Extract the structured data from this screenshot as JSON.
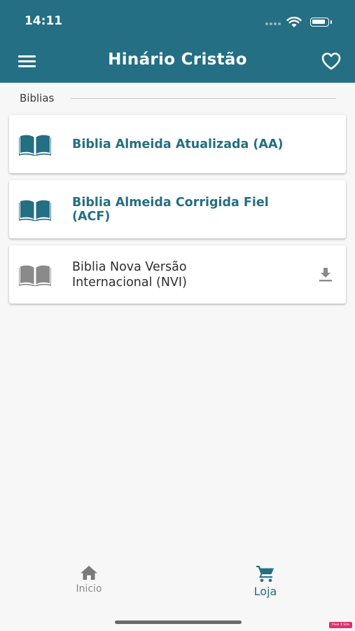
{
  "status_bar": {
    "time": "14:11"
  },
  "header": {
    "title": "Hinário Cristão",
    "menu_icon": "hamburger-icon",
    "favorites_icon": "heart-outline-icon"
  },
  "section": {
    "label": "Biblias"
  },
  "bibles": [
    {
      "title": "Biblia Almeida Atualizada (AA)",
      "owned": true,
      "icon": "book-open-icon"
    },
    {
      "title": "Biblia Almeida Corrigida Fiel (ACF)",
      "owned": true,
      "icon": "book-open-icon"
    },
    {
      "title": "Biblia Nova Versão Internacional (NVI)",
      "owned": false,
      "icon": "book-open-icon",
      "action_icon": "download-icon"
    }
  ],
  "bottom_nav": {
    "items": [
      {
        "label": "Inicio",
        "icon": "home-icon",
        "active": false
      },
      {
        "label": "Loja",
        "icon": "cart-icon",
        "active": true
      }
    ]
  },
  "watermark": "Pixel X Site",
  "colors": {
    "primary": "#246f84",
    "background": "#f7f7f7",
    "card": "#ffffff",
    "inactive_icon": "#8a8a8a",
    "watermark": "#e0306f"
  }
}
